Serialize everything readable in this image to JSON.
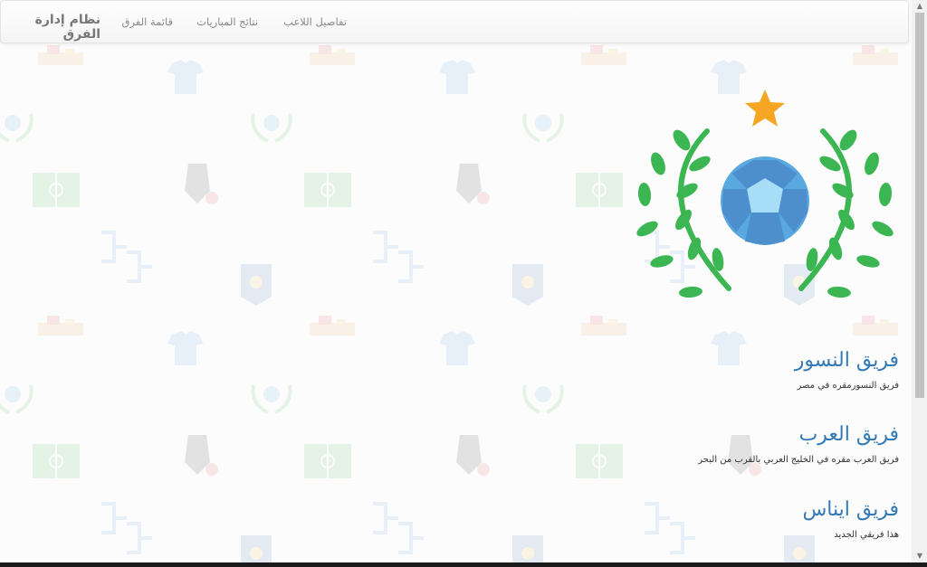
{
  "navbar": {
    "brand": "نظام إدارة الفرق",
    "links": [
      "قائمة الفرق",
      "نتائج المباريات",
      "تفاصيل اللاعب"
    ]
  },
  "teams": [
    {
      "name": "فريق النسور",
      "description": "فريق النسورمقره في مصر"
    },
    {
      "name": "فريق العرب",
      "description": "فريق العرب مقره في الخليج العربي بالقرب من البحر"
    },
    {
      "name": "فريق ايناس",
      "description": "هذا فريقي الجديد"
    }
  ],
  "colors": {
    "accent": "#337ab7",
    "laurel": "#3cb553",
    "ball": "#5aa8e0",
    "star": "#f6a623"
  },
  "icons": [
    "trophy-laurel-ball-icon",
    "star-icon"
  ]
}
